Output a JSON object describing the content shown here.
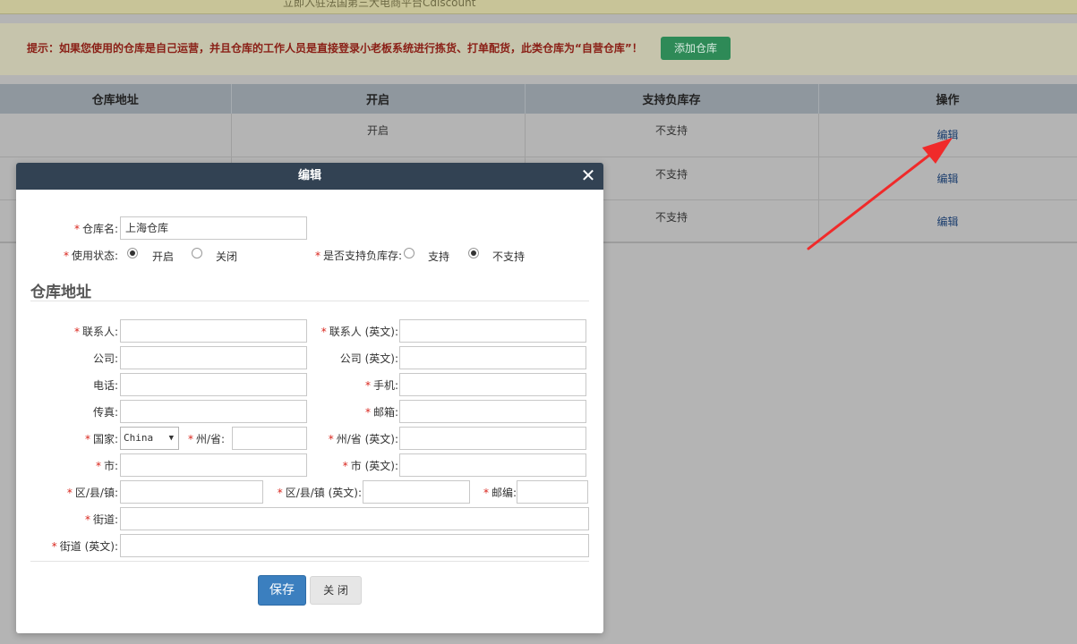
{
  "banner": {
    "text": "立即入驻法国第三大电商平台Cdiscount"
  },
  "tip": {
    "text": "提示：如果您使用的仓库是自己运营，并且仓库的工作人员是直接登录小老板系统进行拣货、打单配货，此类仓库为“自营仓库”！",
    "add_button": "添加仓库"
  },
  "table": {
    "headers": [
      "仓库地址",
      "开启",
      "支持负库存",
      "操作"
    ],
    "rows": [
      {
        "address": "",
        "enabled": "开启",
        "negative_stock": "不支持",
        "action": "编辑"
      },
      {
        "address": "",
        "enabled": "",
        "negative_stock": "不支持",
        "action": "编辑"
      },
      {
        "address": "",
        "enabled": "",
        "negative_stock": "不支持",
        "action": "编辑"
      }
    ]
  },
  "modal": {
    "title": "编辑",
    "close_icon": "close-icon",
    "required_mark": "*",
    "warehouse_name_label": "仓库名:",
    "warehouse_name_value": "上海仓库",
    "status_label": "使用状态:",
    "status_on": "开启",
    "status_off": "关闭",
    "negative_label": "是否支持负库存:",
    "negative_yes": "支持",
    "negative_no": "不支持",
    "section_title": "仓库地址",
    "contact_label": "联系人:",
    "contact_en_label": "联系人 (英文):",
    "company_label": "公司:",
    "company_en_label": "公司 (英文):",
    "phone_label": "电话:",
    "mobile_label": "手机:",
    "fax_label": "传真:",
    "email_label": "邮箱:",
    "country_label": "国家:",
    "country_value": "China",
    "province_label": "州/省:",
    "province_en_label": "州/省 (英文):",
    "city_label": "市:",
    "city_en_label": "市 (英文):",
    "district_label": "区/县/镇:",
    "district_en_label": "区/县/镇 (英文):",
    "zip_label": "邮编:",
    "street_label": "街道:",
    "street_en_label": "街道 (英文):",
    "save_button": "保存",
    "close_button": "关 闭"
  },
  "colors": {
    "header": "#324253",
    "save": "#3b7fbf",
    "required": "#d9251c",
    "add_button": "#2e8a57",
    "annotation_arrow": "#f02a2a"
  }
}
